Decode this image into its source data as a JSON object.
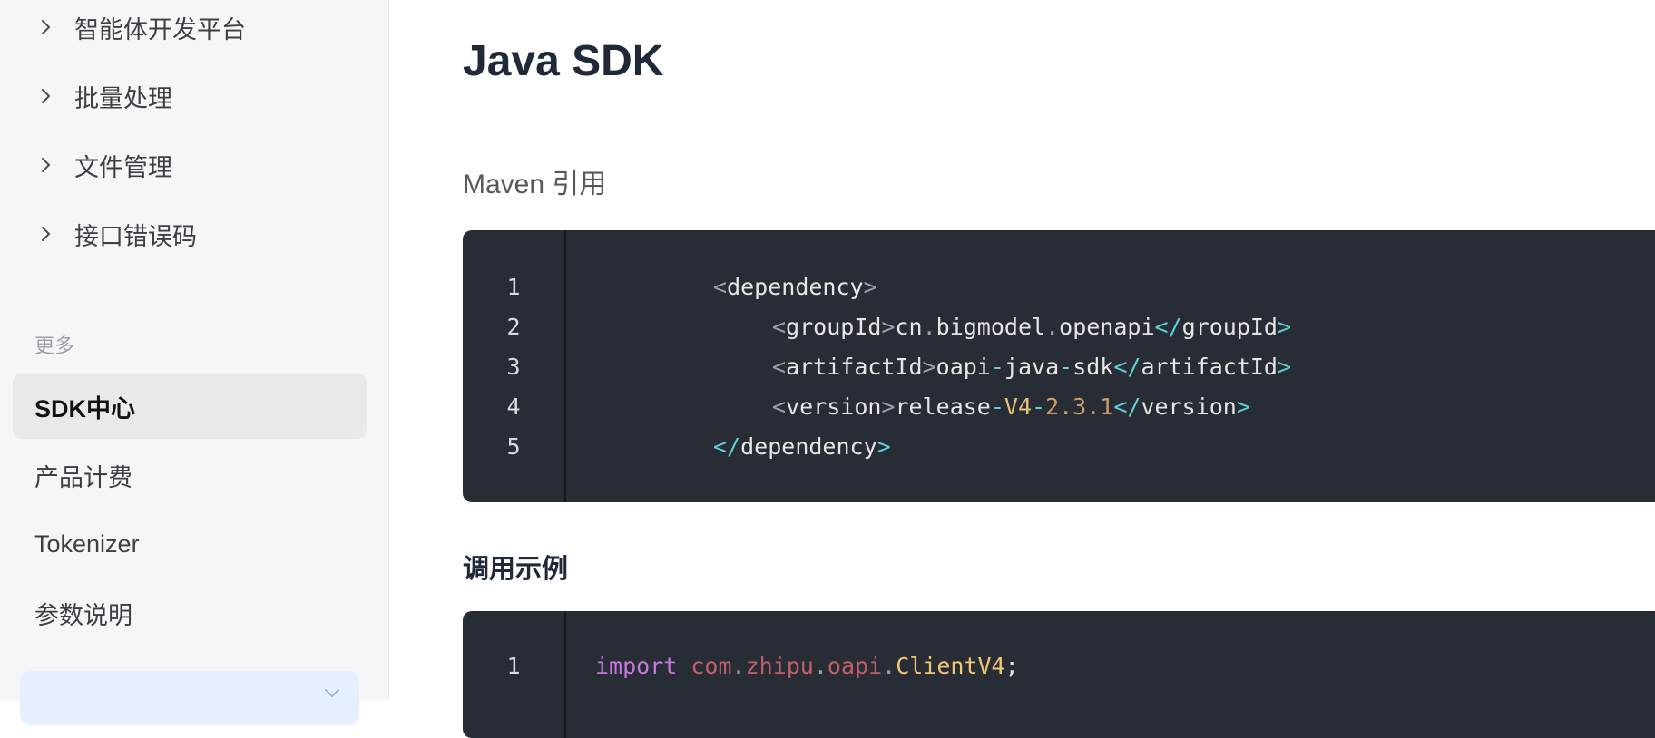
{
  "sidebar": {
    "groups": [
      {
        "label": "智能体开发平台"
      },
      {
        "label": "批量处理"
      },
      {
        "label": "文件管理"
      },
      {
        "label": "接口错误码"
      }
    ],
    "section_label": "更多",
    "items": [
      {
        "label": "SDK中心",
        "active": true
      },
      {
        "label": "产品计费",
        "active": false
      },
      {
        "label": "Tokenizer",
        "active": false
      },
      {
        "label": "参数说明",
        "active": false
      }
    ]
  },
  "main": {
    "title": "Java SDK",
    "maven_heading": "Maven 引用",
    "example_heading": "调用示例",
    "maven_code": {
      "line_numbers": [
        "1",
        "2",
        "3",
        "4",
        "5"
      ],
      "lines": [
        [
          {
            "t": "<",
            "c": "tk-p"
          },
          {
            "t": "dependency",
            "c": ""
          },
          {
            "t": ">",
            "c": "tk-p"
          }
        ],
        [
          {
            "t": "<",
            "c": "tk-p"
          },
          {
            "t": "groupId",
            "c": ""
          },
          {
            "t": ">",
            "c": "tk-p"
          },
          {
            "t": "cn",
            "c": ""
          },
          {
            "t": ".",
            "c": "tk-p"
          },
          {
            "t": "bigmodel",
            "c": ""
          },
          {
            "t": ".",
            "c": "tk-p"
          },
          {
            "t": "openapi",
            "c": ""
          },
          {
            "t": "</",
            "c": "tk-t"
          },
          {
            "t": "groupId",
            "c": ""
          },
          {
            "t": ">",
            "c": "tk-t"
          }
        ],
        [
          {
            "t": "<",
            "c": "tk-p"
          },
          {
            "t": "artifactId",
            "c": ""
          },
          {
            "t": ">",
            "c": "tk-p"
          },
          {
            "t": "oapi",
            "c": ""
          },
          {
            "t": "-",
            "c": "tk-t"
          },
          {
            "t": "java",
            "c": ""
          },
          {
            "t": "-",
            "c": "tk-t"
          },
          {
            "t": "sdk",
            "c": ""
          },
          {
            "t": "</",
            "c": "tk-t"
          },
          {
            "t": "artifactId",
            "c": ""
          },
          {
            "t": ">",
            "c": "tk-t"
          }
        ],
        [
          {
            "t": "<",
            "c": "tk-p"
          },
          {
            "t": "version",
            "c": ""
          },
          {
            "t": ">",
            "c": "tk-p"
          },
          {
            "t": "release",
            "c": ""
          },
          {
            "t": "-",
            "c": "tk-t"
          },
          {
            "t": "V4",
            "c": "tk-v"
          },
          {
            "t": "-",
            "c": "tk-t"
          },
          {
            "t": "2.3.1",
            "c": "tk-n"
          },
          {
            "t": "</",
            "c": "tk-t"
          },
          {
            "t": "version",
            "c": ""
          },
          {
            "t": ">",
            "c": "tk-t"
          }
        ],
        [
          {
            "t": "</",
            "c": "tk-t"
          },
          {
            "t": "dependency",
            "c": ""
          },
          {
            "t": ">",
            "c": "tk-t"
          }
        ]
      ]
    },
    "example_code": {
      "line_numbers": [
        "1"
      ],
      "lines": [
        [
          {
            "t": "import",
            "c": "tk-k"
          },
          {
            "t": " ",
            "c": ""
          },
          {
            "t": "com",
            "c": "tk-pk"
          },
          {
            "t": ".",
            "c": "tk-p"
          },
          {
            "t": "zhipu",
            "c": "tk-pk"
          },
          {
            "t": ".",
            "c": "tk-p"
          },
          {
            "t": "oapi",
            "c": "tk-pk"
          },
          {
            "t": ".",
            "c": "tk-p"
          },
          {
            "t": "ClientV4",
            "c": "tk-c"
          },
          {
            "t": ";",
            "c": ""
          }
        ]
      ]
    }
  }
}
